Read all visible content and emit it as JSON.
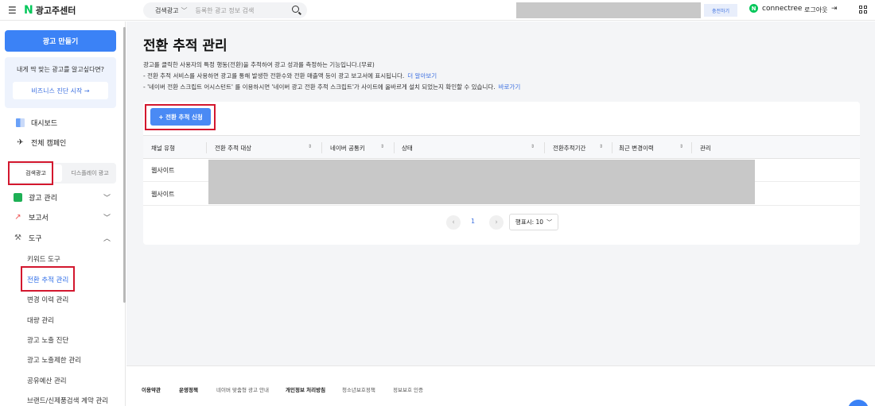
{
  "topbar": {
    "logo_n": "N",
    "logo_text": "광고주센터",
    "search_type": "검색광고",
    "search_placeholder": "등록한 광고 정보 검색",
    "charge_label": "충전하기",
    "account_name": "connectree",
    "logout_label": "로그아웃"
  },
  "sidebar": {
    "create_label": "광고 만들기",
    "promo_text": "내게 딱 맞는 광고를 알고싶다면?",
    "promo_button": "비즈니스 진단 시작 →",
    "dashboard": "대시보드",
    "all_campaigns": "전체 캠페인",
    "tabs": [
      "검색광고",
      "디스플레이 광고"
    ],
    "menu": {
      "ad_manage": "광고 관리",
      "report": "보고서",
      "tools": "도구"
    },
    "tool_items": [
      "키워드 도구",
      "전환 추적 관리",
      "변경 이력 관리",
      "대량 관리",
      "광고 노출 진단",
      "광고 노출제한 관리",
      "공유예산 관리",
      "브랜드/신제품검색 계약 관리"
    ]
  },
  "main": {
    "title": "전환 추적 관리",
    "desc1": "광고를 클릭한 사용자의 특정 행동(전환)을 추적하여 광고 성과를 측정하는 기능입니다.(무료)",
    "desc2": "- 전환 추적 서비스를 사용하면 광고를 통해 발생한 전환수와 전환 매출액 등이 광고 보고서에 표시됩니다.",
    "desc2_link": "더 알아보기",
    "desc3": "- '네이버 전환 스크립트 어시스턴트' 를 이용하시면 '네이버 광고 전환 추적 스크립트'가 사이트에 올바르게 설치 되었는지 확인할 수 있습니다.",
    "desc3_link": "바로가기",
    "apply_button": "+ 전환 추적 신청",
    "columns": [
      "채널 유형",
      "전환 추적 대상",
      "네이버 공통키",
      "상태",
      "전환추적기간",
      "최근 변경이력",
      "관리"
    ],
    "rows": [
      {
        "channel": "웹사이트"
      },
      {
        "channel": "웹사이트"
      }
    ],
    "page_number": "1",
    "per_page": "행표시: 10"
  },
  "footer": {
    "links": [
      "이용약관",
      "운영정책",
      "네이버 맞춤형 광고 안내",
      "개인정보 처리방침",
      "청소년보호정책",
      "정보보호 인증"
    ]
  },
  "colors": {
    "primary": "#3b82f6",
    "highlight_red": "#d3172e",
    "naver_green": "#03c75a"
  }
}
